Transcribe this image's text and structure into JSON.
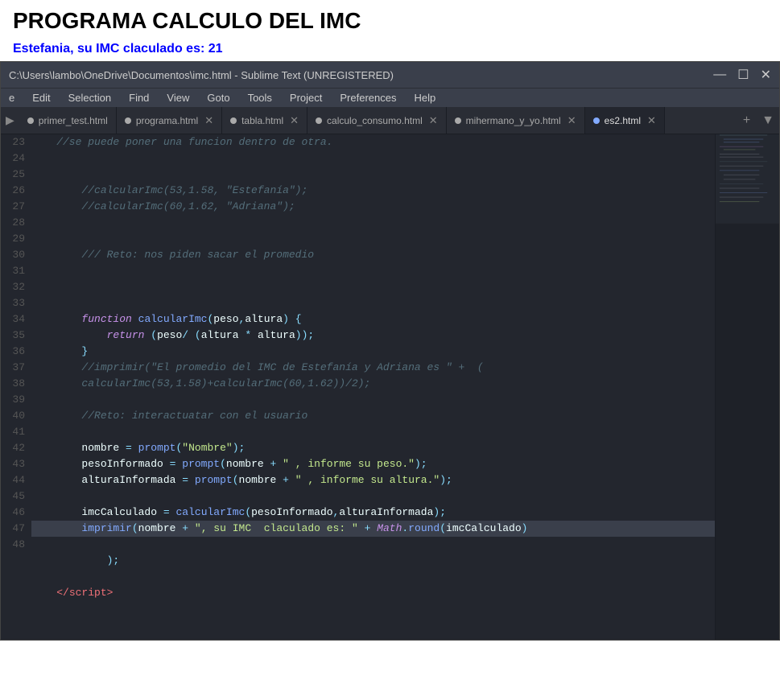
{
  "page": {
    "title": "PROGRAMA CALCULO DEL IMC",
    "subtitle_prefix": "Estefania, su IMC claculado es: ",
    "subtitle_value": "21"
  },
  "window": {
    "title": "C:\\Users\\lambo\\OneDrive\\Documentos\\imc.html - Sublime Text (UNREGISTERED)",
    "minimize": "—",
    "maximize": "☐",
    "close": "✕"
  },
  "menubar": {
    "items": [
      "e",
      "Edit",
      "Selection",
      "Find",
      "View",
      "Goto",
      "Tools",
      "Project",
      "Preferences",
      "Help"
    ]
  },
  "tabs": [
    {
      "label": "primer_test.html",
      "dot_color": "#aaa",
      "active": false,
      "closable": false
    },
    {
      "label": "programa.html",
      "dot_color": "#aaa",
      "active": false,
      "closable": true
    },
    {
      "label": "tabla.html",
      "dot_color": "#aaa",
      "active": false,
      "closable": true
    },
    {
      "label": "calculo_consumo.html",
      "dot_color": "#aaa",
      "active": false,
      "closable": true
    },
    {
      "label": "mihermano_y_yo.html",
      "dot_color": "#aaa",
      "active": false,
      "closable": true
    },
    {
      "label": "es2.html",
      "dot_color": "#aaa",
      "active": true,
      "closable": true
    }
  ],
  "line_numbers": [
    23,
    24,
    25,
    26,
    27,
    28,
    29,
    30,
    31,
    32,
    33,
    34,
    35,
    36,
    37,
    38,
    39,
    40,
    41,
    42,
    43,
    44,
    45,
    46,
    47,
    48
  ],
  "colors": {
    "bg": "#23262e",
    "line_highlight": "#2e3340",
    "active_line": "#3a3f4b"
  }
}
